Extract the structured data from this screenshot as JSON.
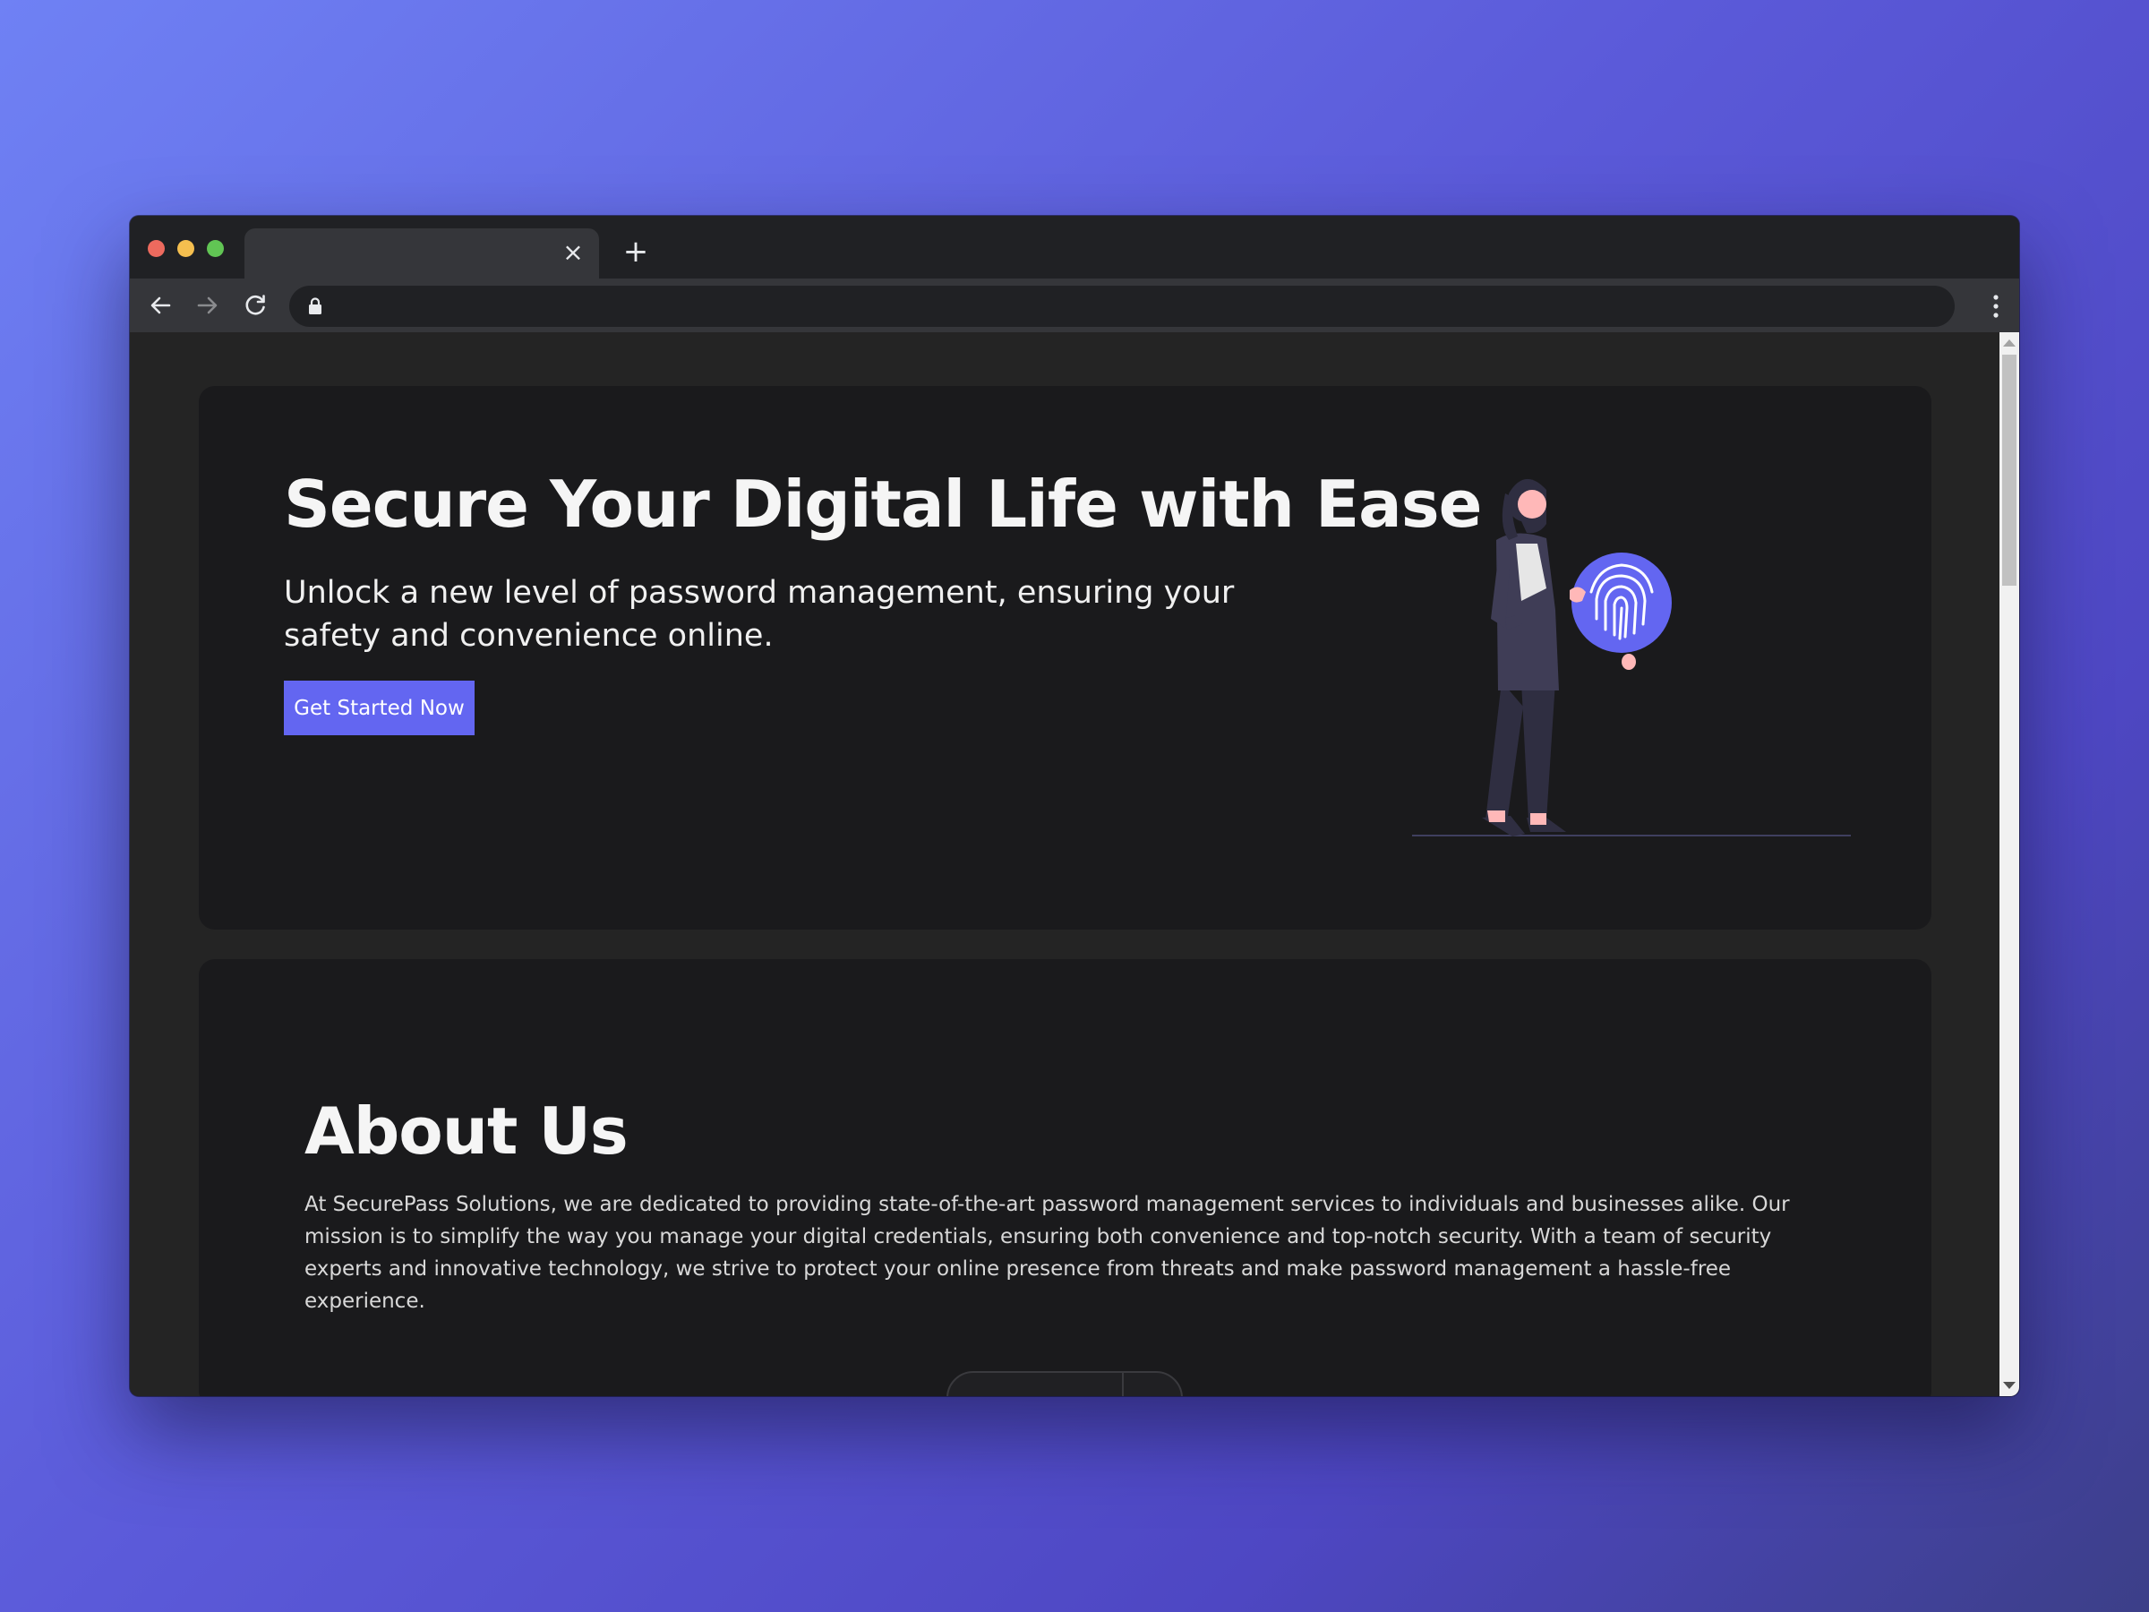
{
  "browser": {
    "tab_title": "",
    "tab_close_icon": "×",
    "new_tab_icon": "+",
    "url": "",
    "icons": [
      "close-dot-icon",
      "minimize-dot-icon",
      "maximize-dot-icon",
      "back-arrow-icon",
      "forward-arrow-icon",
      "reload-icon",
      "lock-icon",
      "kebab-menu-icon"
    ]
  },
  "hero": {
    "title": "Secure Your Digital Life with Ease",
    "subtitle": "Unlock a new level of password management, ensuring your safety and convenience online.",
    "cta_label": "Get Started Now",
    "illustration": "person-holding-fingerprint-icon"
  },
  "about": {
    "title": "About Us",
    "text": "At SecurePass Solutions, we are dedicated to providing state-of-the-art password management services to individuals and businesses alike. Our mission is to simplify the way you manage your digital credentials, ensuring both convenience and top-notch security. With a team of security experts and innovative technology, we strive to protect your online presence from threats and make password management a hassle-free experience."
  },
  "colors": {
    "accent": "#6366f1",
    "card_bg": "#1a1a1c",
    "page_bg": "#242424",
    "backdrop_start": "#6f81f4",
    "backdrop_end": "#3c3f88"
  }
}
